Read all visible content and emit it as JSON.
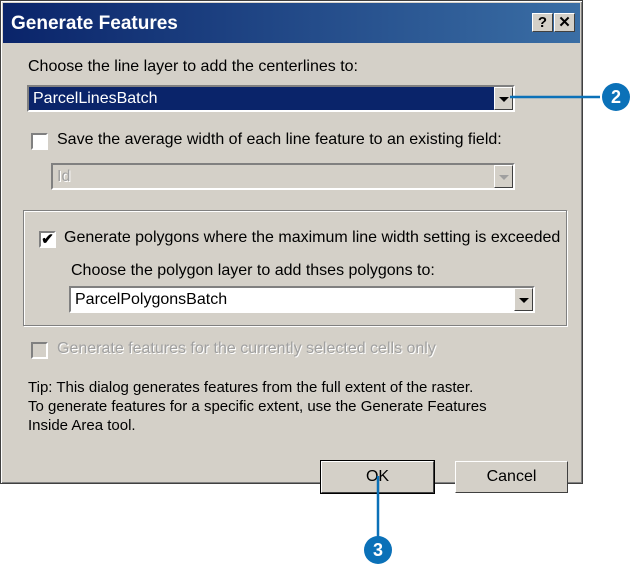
{
  "window": {
    "title": "Generate Features",
    "help_label": "?",
    "close_label": "✕"
  },
  "line_layer": {
    "label": "Choose the line layer to add the centerlines to:",
    "value": "ParcelLinesBatch"
  },
  "save_width": {
    "label": "Save the average width of each line feature to an existing field:",
    "checked": false,
    "field_value": "Id"
  },
  "polygons": {
    "label": "Generate polygons where the maximum line width setting is exceeded",
    "checked": true,
    "check_mark": "✔",
    "layer_label": "Choose the polygon layer to add thses polygons to:",
    "layer_value": "ParcelPolygonsBatch"
  },
  "selected_cells": {
    "label": "Generate features for the currently selected cells only",
    "checked": false
  },
  "tip": {
    "line1": "Tip:  This dialog generates features from the full extent of the raster.",
    "line2": "To generate features for a specific extent, use the Generate Features",
    "line3": "Inside Area tool."
  },
  "buttons": {
    "ok": "OK",
    "cancel": "Cancel"
  },
  "callouts": {
    "two": "2",
    "three": "3",
    "color": "#0b71b8"
  }
}
